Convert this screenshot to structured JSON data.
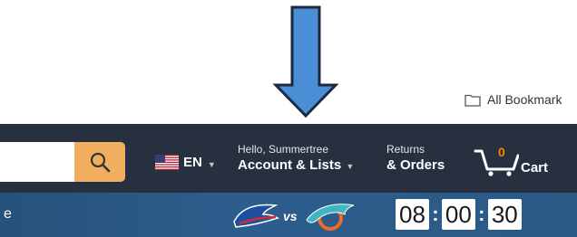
{
  "bookmarks": {
    "label": "All Bookmark",
    "icon": "folder-icon"
  },
  "navbar": {
    "search": {
      "placeholder": "",
      "button_icon": "search-icon"
    },
    "language": {
      "code": "EN",
      "flag_icon": "us-flag-icon"
    },
    "account": {
      "greeting": "Hello, Summertree",
      "label": "Account & Lists"
    },
    "orders": {
      "line1": "Returns",
      "line2": "& Orders"
    },
    "cart": {
      "count": "0",
      "label": "Cart",
      "icon": "cart-icon"
    }
  },
  "subbar": {
    "left_text": "e",
    "matchup": {
      "vs_text": "vs",
      "team1_icon": "bills-logo-icon",
      "team2_icon": "dolphins-logo-icon"
    },
    "timer": {
      "hours": "08",
      "minutes": "00",
      "seconds": "30"
    }
  },
  "colors": {
    "nav_bg": "#26303e",
    "search_button": "#f0ae5e",
    "cart_count": "#f08804",
    "subbar_bg": "#2b5a87",
    "arrow": "#4a8fd6"
  }
}
